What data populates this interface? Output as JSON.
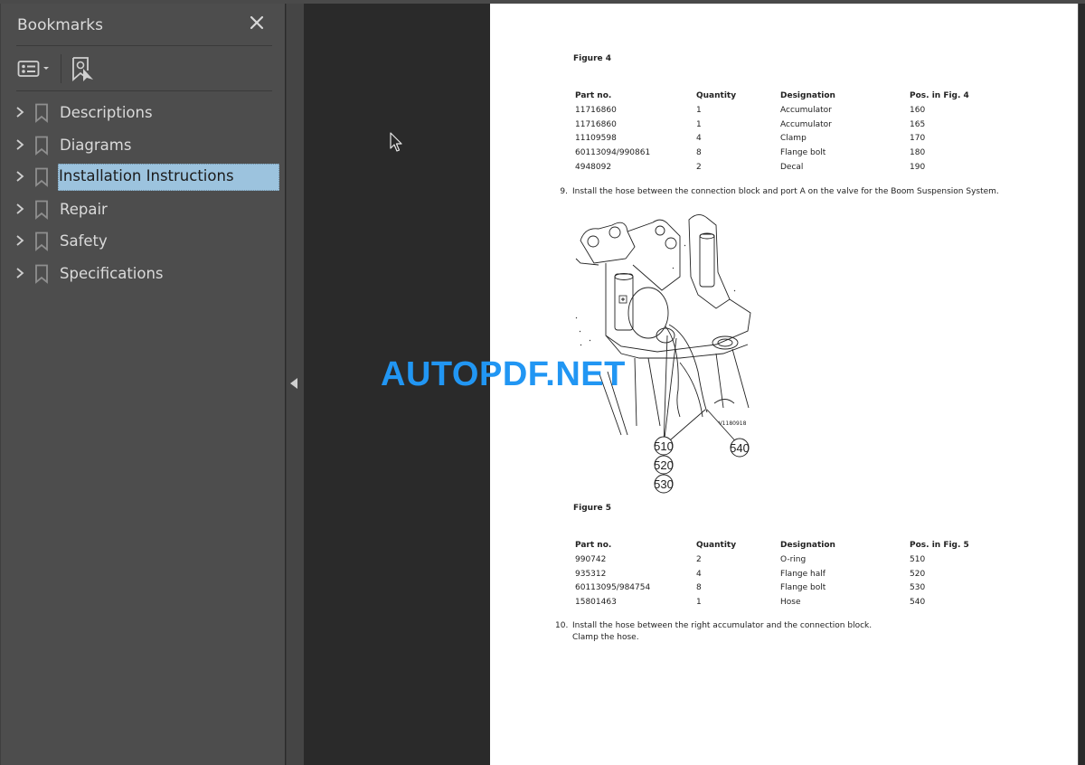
{
  "sidebar": {
    "title": "Bookmarks",
    "close_icon": "close-icon",
    "tools": [
      {
        "name": "bookmark-options",
        "icon": "list-options-icon",
        "has_dropdown": true
      },
      {
        "name": "find-current-bookmark",
        "icon": "bookmark-search-icon"
      }
    ],
    "items": [
      {
        "label": "Descriptions",
        "selected": false
      },
      {
        "label": "Diagrams",
        "selected": false
      },
      {
        "label": "Installation Instructions",
        "selected": true
      },
      {
        "label": "Repair",
        "selected": false
      },
      {
        "label": "Safety",
        "selected": false
      },
      {
        "label": "Specifications",
        "selected": false
      }
    ]
  },
  "splitter": {
    "icon": "collapse-left-icon"
  },
  "document": {
    "figure4": {
      "caption": "Figure 4",
      "headers": [
        "Part no.",
        "Quantity",
        "Designation",
        "Pos. in Fig. 4"
      ],
      "rows": [
        [
          "11716860",
          "1",
          "Accumulator",
          "160"
        ],
        [
          "11716860",
          "1",
          "Accumulator",
          "165"
        ],
        [
          "11109598",
          "4",
          "Clamp",
          "170"
        ],
        [
          "60113094/990861",
          "8",
          "Flange bolt",
          "180"
        ],
        [
          "4948092",
          "2",
          "Decal",
          "190"
        ]
      ]
    },
    "step9": {
      "num": "9.",
      "text": "Install the hose between the connection block and port A on the valve for the Boom Suspension System."
    },
    "diagram": {
      "image_id_label": "V1180918",
      "callouts": [
        "510",
        "520",
        "530",
        "540"
      ]
    },
    "figure5": {
      "caption": "Figure 5",
      "headers": [
        "Part no.",
        "Quantity",
        "Designation",
        "Pos. in Fig. 5"
      ],
      "rows": [
        [
          "990742",
          "2",
          "O-ring",
          "510"
        ],
        [
          "935312",
          "4",
          "Flange half",
          "520"
        ],
        [
          "60113095/984754",
          "8",
          "Flange bolt",
          "530"
        ],
        [
          "15801463",
          "1",
          "Hose",
          "540"
        ]
      ]
    },
    "step10": {
      "num": "10.",
      "lines": [
        "Install the hose between the right accumulator and the connection block.",
        "Clamp the hose."
      ]
    }
  },
  "watermark": {
    "text": "AUTOPDF.NET",
    "color": "#2196f3"
  },
  "colors": {
    "selection": "#9cc3de",
    "panel": "#4d4d4d",
    "canvas": "#2a2a2a"
  }
}
